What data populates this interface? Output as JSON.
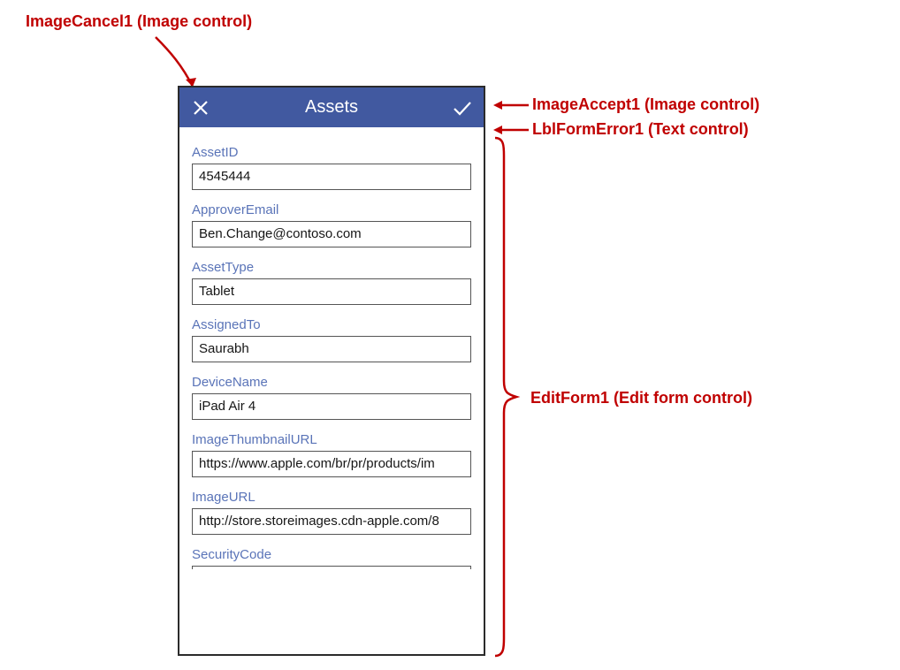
{
  "annotations": {
    "cancel": "ImageCancel1 (Image control)",
    "accept": "ImageAccept1 (Image control)",
    "error": "LblFormError1 (Text control)",
    "form": "EditForm1 (Edit form control)"
  },
  "app": {
    "title": "Assets"
  },
  "form": {
    "fields": [
      {
        "label": "AssetID",
        "value": "4545444"
      },
      {
        "label": "ApproverEmail",
        "value": "Ben.Change@contoso.com"
      },
      {
        "label": "AssetType",
        "value": "Tablet"
      },
      {
        "label": "AssignedTo",
        "value": "Saurabh"
      },
      {
        "label": "DeviceName",
        "value": "iPad Air 4"
      },
      {
        "label": "ImageThumbnailURL",
        "value": "https://www.apple.com/br/pr/products/im"
      },
      {
        "label": "ImageURL",
        "value": "http://store.storeimages.cdn-apple.com/8"
      },
      {
        "label": "SecurityCode",
        "value": ""
      }
    ]
  }
}
